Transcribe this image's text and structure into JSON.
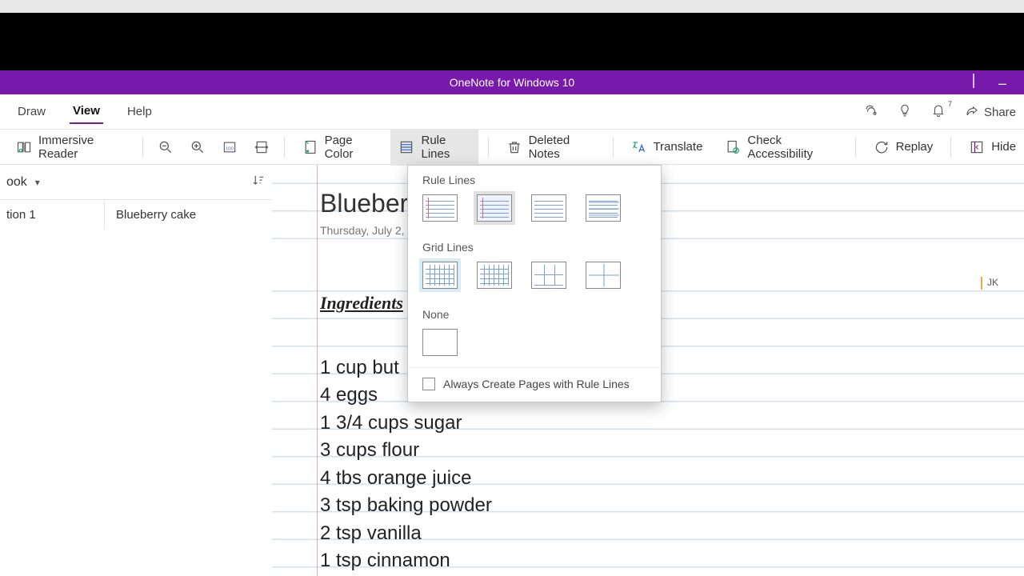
{
  "app_title": "OneNote for Windows 10",
  "menu_tabs": {
    "draw": "Draw",
    "view": "View",
    "help": "Help"
  },
  "header_right": {
    "share": "Share",
    "notif_badge": "7"
  },
  "toolbar": {
    "immersive": "Immersive Reader",
    "page_color": "Page Color",
    "rule_lines": "Rule Lines",
    "deleted_notes": "Deleted Notes",
    "translate": "Translate",
    "check_access": "Check Accessibility",
    "replay": "Replay",
    "hide": "Hide"
  },
  "notebook": {
    "name": "ook",
    "section": "tion 1",
    "page_item": "Blueberry cake"
  },
  "page": {
    "title_visible": "Blueberr",
    "date_visible": "Thursday, July 2,",
    "heading": "Ingredients",
    "lines": [
      "1 cup but",
      "4 eggs",
      "1 3/4 cups sugar",
      "3 cups flour",
      "4 tbs orange juice",
      "3 tsp baking powder",
      "2 tsp vanilla",
      "1 tsp cinnamon"
    ],
    "author_tag": "JK"
  },
  "dropdown": {
    "rule_label": "Rule Lines",
    "grid_label": "Grid Lines",
    "none_label": "None",
    "always_label": "Always Create Pages with Rule Lines"
  }
}
